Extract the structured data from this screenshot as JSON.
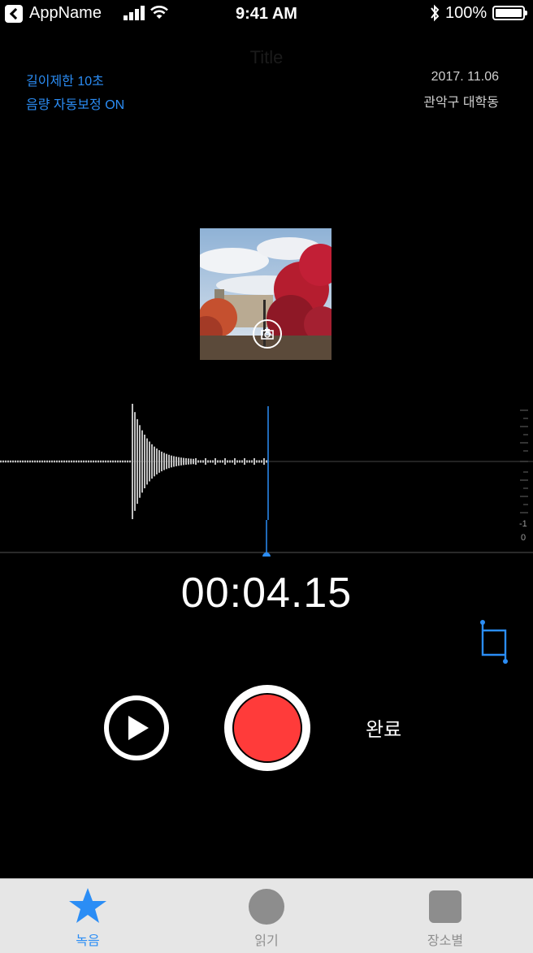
{
  "status_bar": {
    "app_name": "AppName",
    "time": "9:41 AM",
    "battery": "100%"
  },
  "nav": {
    "title": "Title"
  },
  "info": {
    "limit": "길이제한  10초",
    "volume": "음량 자동보정 ON",
    "date": "2017. 11.06",
    "location": "관악구 대학동"
  },
  "waveform": {
    "scale_labels": [
      "-1",
      "0"
    ]
  },
  "timer": "00:04.15",
  "controls": {
    "done_label": "완료"
  },
  "colors": {
    "accent": "#2b8df5",
    "record": "#ff3b3a",
    "tab_bar": "#e6e6e6",
    "tab_inactive": "#8d8d8d"
  },
  "tabs": [
    {
      "label": "녹음",
      "icon": "star-icon",
      "active": true
    },
    {
      "label": "읽기",
      "icon": "circle-icon",
      "active": false
    },
    {
      "label": "장소별",
      "icon": "square-icon",
      "active": false
    }
  ]
}
